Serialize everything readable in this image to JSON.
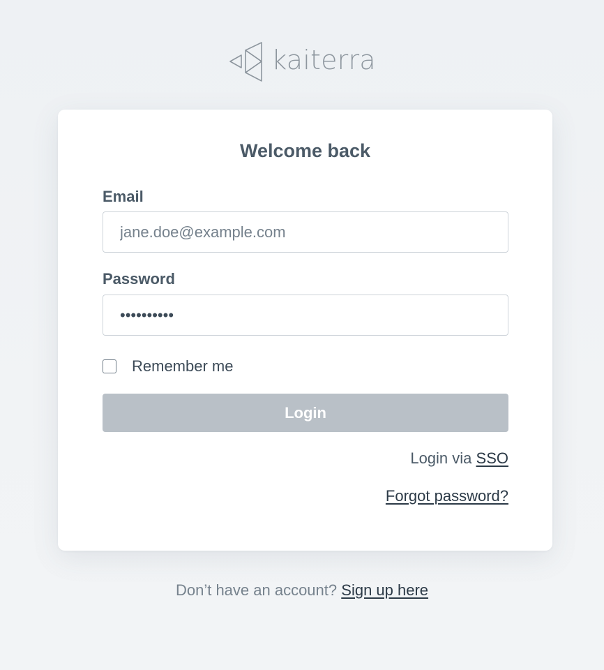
{
  "brand": {
    "name": "kaiterra",
    "logo_icon": "kaiterra-triangles-logo"
  },
  "login_card": {
    "title": "Welcome back",
    "email": {
      "label": "Email",
      "placeholder": "jane.doe@example.com",
      "value": ""
    },
    "password": {
      "label": "Password",
      "value": "••••••••••"
    },
    "remember_me": {
      "label": "Remember me",
      "checked": false
    },
    "login_button": {
      "label": "Login",
      "state": "disabled"
    },
    "sso": {
      "prefix": "Login via",
      "link_label": "SSO"
    },
    "forgot_password": {
      "label": "Forgot password?"
    }
  },
  "footer": {
    "prompt": "Don’t have an account?",
    "signup_label": "Sign up here"
  },
  "colors": {
    "background": "#eef1f4",
    "card": "#ffffff",
    "text": "#4b5a67",
    "muted_text": "#76828d",
    "link": "#2c3a47",
    "button_disabled": "#b9c0c7",
    "logo": "#8e979f"
  }
}
